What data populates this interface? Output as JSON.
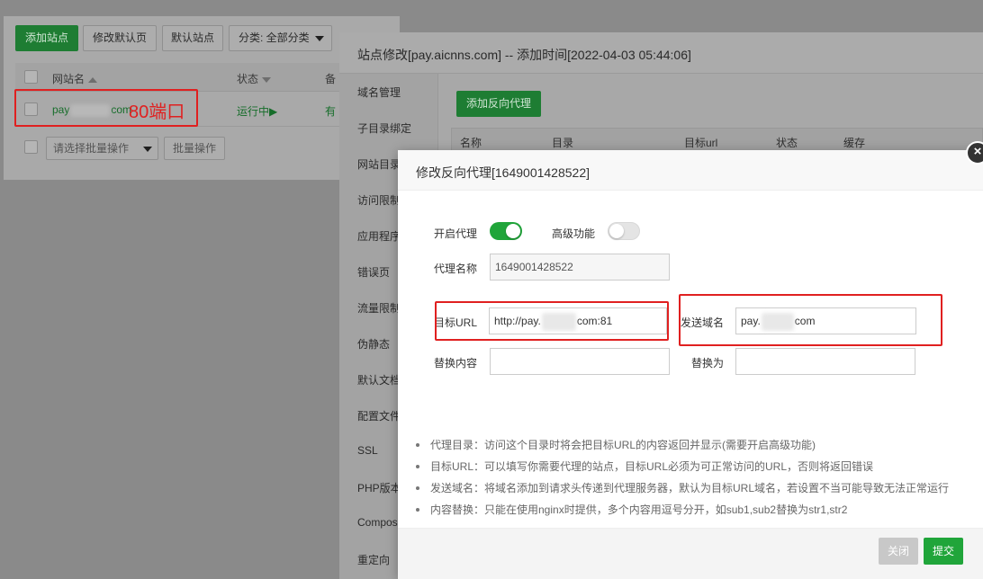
{
  "toolbar": {
    "add_site": "添加站点",
    "edit_default_page": "修改默认页",
    "default_site": "默认站点",
    "category": "分类: 全部分类"
  },
  "site_table": {
    "headers": {
      "site_name": "网站名",
      "status": "状态",
      "remark": "备"
    },
    "rows": [
      {
        "name_prefix": "pay",
        "name_suffix": "com",
        "status": "运行中▶",
        "remark": "有"
      }
    ],
    "batch_placeholder": "请选择批量操作",
    "batch_button": "批量操作"
  },
  "annotation_80": "80端口",
  "site_window": {
    "title": "站点修改[pay.aicnns.com] -- 添加时间[2022-04-03 05:44:06]",
    "nav": [
      "域名管理",
      "子目录绑定",
      "网站目录",
      "访问限制",
      "应用程序",
      "错误页",
      "流量限制",
      "伪静态",
      "默认文档",
      "配置文件",
      "SSL",
      "PHP版本",
      "Compos",
      "重定向"
    ],
    "add_proxy_button": "添加反向代理",
    "proxy_headers": [
      "名称",
      "目录",
      "目标url",
      "状态",
      "缓存"
    ]
  },
  "modal": {
    "title": "修改反向代理[1649001428522]",
    "close_icon": "close-icon",
    "enable_proxy_label": "开启代理",
    "enable_proxy_on": true,
    "advanced_label": "高级功能",
    "advanced_on": false,
    "proxy_name_label": "代理名称",
    "proxy_name_value": "1649001428522",
    "target_url_label": "目标URL",
    "target_url_prefix": "http://pay.",
    "target_url_suffix": "com:81",
    "send_domain_label": "发送域名",
    "send_domain_prefix": "pay.",
    "send_domain_suffix": "com",
    "replace_content_label": "替换内容",
    "replace_with_label": "替换为",
    "tips": [
      "代理目录：访问这个目录时将会把目标URL的内容返回并显示(需要开启高级功能)",
      "目标URL：可以填写你需要代理的站点，目标URL必须为可正常访问的URL，否则将返回错误",
      "发送域名：将域名添加到请求头传递到代理服务器，默认为目标URL域名，若设置不当可能导致无法正常运行",
      "内容替换：只能在使用nginx时提供，多个内容用逗号分开，如sub1,sub2替换为str1,str2"
    ],
    "close_button": "关闭",
    "submit_button": "提交"
  },
  "colors": {
    "accent_green": "#20a53a",
    "annotation_red": "#e02020"
  }
}
